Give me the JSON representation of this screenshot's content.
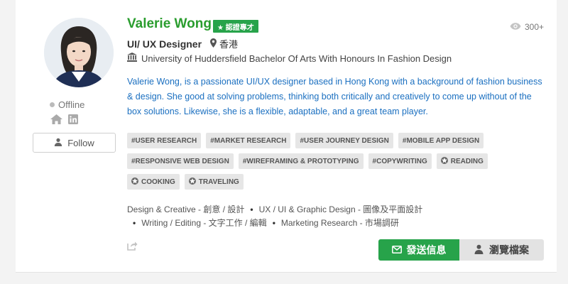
{
  "profile": {
    "name": "Valerie Wong",
    "verified_badge": "★ 認證專才",
    "views": "300+",
    "job_title": "UI/ UX Designer",
    "location": "香港",
    "education": "University of Huddersfield Bachelor Of Arts With Honours In Fashion Design",
    "bio": "Valerie Wong, is a passionate UI/UX designer based in Hong Kong with a background of fashion business & design. She good at solving problems, thinking both critically and creatively to come up without of the box solutions. Likewise, she is a flexible, adaptable, and a great team player.",
    "status": "Offline",
    "follow_label": "Follow"
  },
  "tags": [
    {
      "label": "#USER RESEARCH",
      "badge": false
    },
    {
      "label": "#MARKET RESEARCH",
      "badge": false
    },
    {
      "label": "#USER JOURNEY DESIGN",
      "badge": false
    },
    {
      "label": "#MOBILE APP DESIGN",
      "badge": false
    },
    {
      "label": "#RESPONSIVE WEB DESIGN",
      "badge": false
    },
    {
      "label": "#WIREFRAMING & PROTOTYPING",
      "badge": false
    },
    {
      "label": "#COPYWRITING",
      "badge": false
    },
    {
      "label": "READING",
      "badge": true
    },
    {
      "label": "COOKING",
      "badge": true
    },
    {
      "label": "TRAVELING",
      "badge": true
    }
  ],
  "categories": {
    "c1": "Design & Creative - 創意 / 設計",
    "c2": "UX / UI & Graphic Design - 圖像及平面設計",
    "c3": "Writing / Editing - 文字工作 / 編輯",
    "c4": "Marketing Research - 市場調研",
    "separator": "•"
  },
  "actions": {
    "message_label": "發送信息",
    "view_profile_label": "瀏覽檔案"
  },
  "colors": {
    "accent_green": "#27a34a",
    "name_green": "#2a9d2e",
    "bio_blue": "#1a6fc0",
    "tag_bg": "#e6e6e6"
  }
}
